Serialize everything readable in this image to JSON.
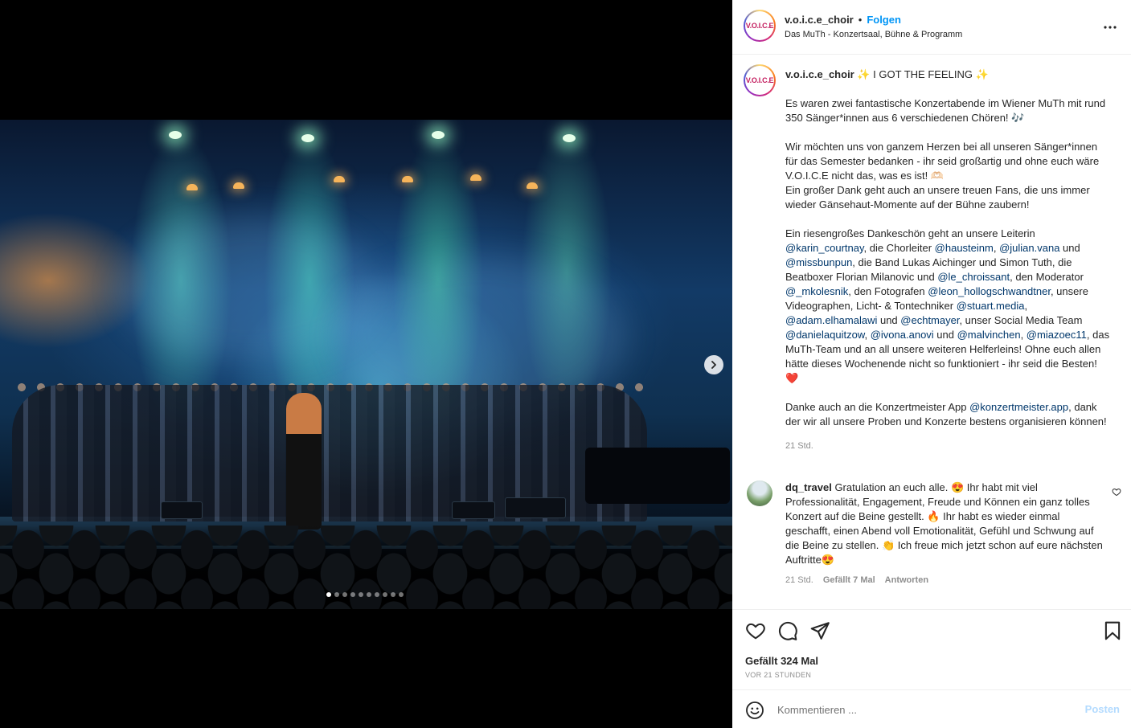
{
  "post": {
    "username": "v.o.i.c.e_choir",
    "follow_label": "Folgen",
    "separator": "•",
    "location": "Das MuTh - Konzertsaal, Bühne & Programm",
    "avatar_text": "V.O.I.C.E",
    "more_icon": "more-horizontal-icon",
    "carousel": {
      "slide_count": 10,
      "active_index": 0,
      "next_icon": "chevron-right-icon"
    }
  },
  "caption": {
    "username": "v.o.i.c.e_choir",
    "title": "✨ I GOT THE FEELING ✨",
    "paragraph1": "Es waren zwei fantastische Konzertabende im Wiener MuTh mit rund 350 Sänger*innen aus 6 verschiedenen Chören! 🎶",
    "paragraph2_a": "Wir möchten uns von ganzem Herzen bei all unseren Sänger*innen für das Semester bedanken - ihr seid großartig und ohne euch wäre V.O.I.C.E nicht das, was es ist! 🫶🏻",
    "paragraph2_b": "Ein großer Dank geht auch an unsere treuen Fans, die uns immer wieder Gänsehaut-Momente auf der Bühne zaubern!",
    "p3": {
      "t1": "Ein riesengroßes Dankeschön geht an unsere Leiterin ",
      "m1": "@karin_courtnay",
      "t2": ", die Chorleiter ",
      "m2": "@hausteinm",
      "t3": ", ",
      "m3": "@julian.vana",
      "t4": " und ",
      "m4": "@missbunpun",
      "t5": ", die Band Lukas Aichinger und Simon Tuth, die Beatboxer Florian Milanovic und ",
      "m5": "@le_chroissant",
      "t6": ", den Moderator ",
      "m6": "@_mkolesnik",
      "t7": ", den Fotografen ",
      "m7": "@leon_hollogschwandtner",
      "t8": ", unsere Videographen, Licht- & Tontechniker ",
      "m8": "@stuart.media",
      "t9": ", ",
      "m9": "@adam.elhamalawi",
      "t10": " und ",
      "m10": "@echtmayer",
      "t11": ", unser Social Media Team ",
      "m11": "@danielaquitzow",
      "t12": ", ",
      "m12": "@ivona.anovi",
      "t13": " und ",
      "m13": "@malvinchen",
      "t14": ", ",
      "m14": "@miazoec11",
      "t15": ", das MuTh-Team und an all unsere weiteren Helferleins! Ohne euch allen hätte dieses Wochenende nicht so funktioniert - ihr seid die Besten! ❤️"
    },
    "p4": {
      "t1": "Danke auch an die Konzertmeister App ",
      "m1": "@konzertmeister.app",
      "t2": ", dank der wir all unsere Proben und Konzerte bestens organisieren können!"
    },
    "time": "21 Std."
  },
  "comment": {
    "username": "dq_travel",
    "text": "Gratulation an euch alle. 😍 Ihr habt mit viel Professionalität, Engagement, Freude und Können ein ganz tolles Konzert auf die Beine gestellt. 🔥 Ihr habt es wieder einmal geschafft, einen Abend voll Emotionalität, Gefühl und Schwung auf die Beine zu stellen. 👏 Ich freue mich jetzt schon auf eure nächsten Auftritte😍",
    "time": "21 Std.",
    "likes": "Gefällt 7 Mal",
    "reply": "Antworten"
  },
  "actions": {
    "likes": "Gefällt 324 Mal",
    "timestamp": "VOR 21 STUNDEN"
  },
  "composer": {
    "placeholder": "Kommentieren ...",
    "post_label": "Posten"
  }
}
